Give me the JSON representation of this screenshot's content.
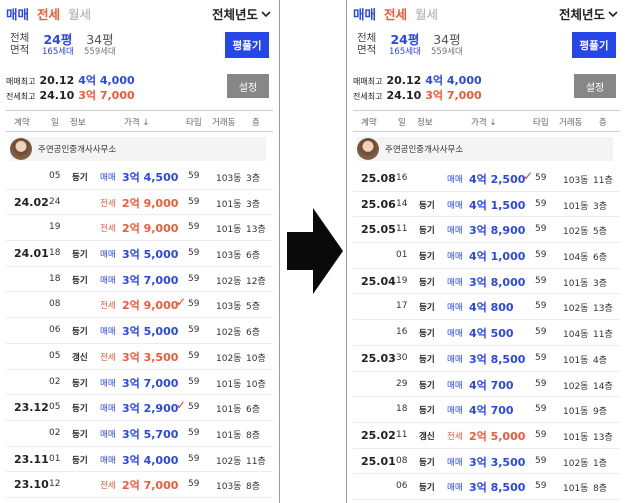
{
  "panels": [
    {
      "tabs": {
        "trade": "매매",
        "jeonse": "전세",
        "wolse": "월세"
      },
      "year_select": "전체년도",
      "area": {
        "label_top": "전체",
        "label_bottom": "면적",
        "selected_big": "24평",
        "selected_small": "165세대",
        "other_big": "34평",
        "other_small": "559세대"
      },
      "compare_label": "평풀기",
      "stats": [
        {
          "label": "매매최고",
          "date": "20.12",
          "price": "4억 4,000",
          "kind": "trade"
        },
        {
          "label": "전세최고",
          "date": "24.10",
          "price": "3억 7,000",
          "kind": "jeonse"
        }
      ],
      "settings_label": "설정",
      "headers": {
        "contract": "계약",
        "day": "일",
        "info": "정보",
        "price": "가격 ↓",
        "type": "타입",
        "dong": "거래동",
        "floor": "층"
      },
      "agent_name": "주연공인중개사사무소",
      "rows": [
        {
          "month": "",
          "day": "05",
          "info": "등기",
          "kind": "매매",
          "price": "3억 4,500",
          "check": "",
          "type": "59",
          "dong": "103동",
          "floor": "3층",
          "deal": "trade"
        },
        {
          "month": "24.02",
          "day": "24",
          "info": "",
          "kind": "전세",
          "price": "2억 9,000",
          "check": "",
          "type": "59",
          "dong": "101동",
          "floor": "3층",
          "deal": "jeonse"
        },
        {
          "month": "",
          "day": "19",
          "info": "",
          "kind": "전세",
          "price": "2억 9,000",
          "check": "",
          "type": "59",
          "dong": "101동",
          "floor": "13층",
          "deal": "jeonse"
        },
        {
          "month": "24.01",
          "day": "18",
          "info": "등기",
          "kind": "매매",
          "price": "3억 5,000",
          "check": "",
          "type": "59",
          "dong": "103동",
          "floor": "6층",
          "deal": "trade"
        },
        {
          "month": "",
          "day": "18",
          "info": "등기",
          "kind": "매매",
          "price": "3억 7,000",
          "check": "",
          "type": "59",
          "dong": "102동",
          "floor": "12층",
          "deal": "trade"
        },
        {
          "month": "",
          "day": "08",
          "info": "",
          "kind": "전세",
          "price": "2억 9,000",
          "check": "✓",
          "type": "59",
          "dong": "103동",
          "floor": "5층",
          "deal": "jeonse"
        },
        {
          "month": "",
          "day": "06",
          "info": "등기",
          "kind": "매매",
          "price": "3억 5,000",
          "check": "",
          "type": "59",
          "dong": "102동",
          "floor": "6층",
          "deal": "trade"
        },
        {
          "month": "",
          "day": "05",
          "info": "갱신",
          "kind": "전세",
          "price": "3억 3,500",
          "check": "",
          "type": "59",
          "dong": "102동",
          "floor": "10층",
          "deal": "jeonse"
        },
        {
          "month": "",
          "day": "02",
          "info": "등기",
          "kind": "매매",
          "price": "3억 7,000",
          "check": "",
          "type": "59",
          "dong": "101동",
          "floor": "10층",
          "deal": "trade"
        },
        {
          "month": "23.12",
          "day": "05",
          "info": "등기",
          "kind": "매매",
          "price": "3억 2,900",
          "check": "✓",
          "type": "59",
          "dong": "101동",
          "floor": "6층",
          "deal": "trade"
        },
        {
          "month": "",
          "day": "02",
          "info": "등기",
          "kind": "매매",
          "price": "3억 5,700",
          "check": "",
          "type": "59",
          "dong": "101동",
          "floor": "8층",
          "deal": "trade"
        },
        {
          "month": "23.11",
          "day": "01",
          "info": "등기",
          "kind": "매매",
          "price": "3억 4,000",
          "check": "",
          "type": "59",
          "dong": "102동",
          "floor": "11층",
          "deal": "trade"
        },
        {
          "month": "23.10",
          "day": "12",
          "info": "",
          "kind": "전세",
          "price": "2억 7,000",
          "check": "",
          "type": "59",
          "dong": "103동",
          "floor": "8층",
          "deal": "jeonse"
        }
      ]
    },
    {
      "tabs": {
        "trade": "매매",
        "jeonse": "전세",
        "wolse": "월세"
      },
      "year_select": "전체년도",
      "area": {
        "label_top": "전체",
        "label_bottom": "면적",
        "selected_big": "24평",
        "selected_small": "165세대",
        "other_big": "34평",
        "other_small": "559세대"
      },
      "compare_label": "평풀기",
      "stats": [
        {
          "label": "매매최고",
          "date": "20.12",
          "price": "4억 4,000",
          "kind": "trade"
        },
        {
          "label": "전세최고",
          "date": "24.10",
          "price": "3억 7,000",
          "kind": "jeonse"
        }
      ],
      "settings_label": "설정",
      "headers": {
        "contract": "계약",
        "day": "일",
        "info": "정보",
        "price": "가격 ↓",
        "type": "타입",
        "dong": "거래동",
        "floor": "층"
      },
      "agent_name": "주연공인중개사사무소",
      "rows": [
        {
          "month": "25.08",
          "day": "16",
          "info": "",
          "kind": "매매",
          "price": "4억 2,500",
          "check": "✓",
          "type": "59",
          "dong": "103동",
          "floor": "11층",
          "deal": "trade"
        },
        {
          "month": "25.06",
          "day": "14",
          "info": "등기",
          "kind": "매매",
          "price": "4억 1,500",
          "check": "",
          "type": "59",
          "dong": "101동",
          "floor": "3층",
          "deal": "trade"
        },
        {
          "month": "25.05",
          "day": "11",
          "info": "등기",
          "kind": "매매",
          "price": "3억 8,900",
          "check": "",
          "type": "59",
          "dong": "102동",
          "floor": "5층",
          "deal": "trade"
        },
        {
          "month": "",
          "day": "01",
          "info": "등기",
          "kind": "매매",
          "price": "4억 1,000",
          "check": "",
          "type": "59",
          "dong": "104동",
          "floor": "6층",
          "deal": "trade"
        },
        {
          "month": "25.04",
          "day": "19",
          "info": "등기",
          "kind": "매매",
          "price": "3억 8,000",
          "check": "",
          "type": "59",
          "dong": "101동",
          "floor": "3층",
          "deal": "trade"
        },
        {
          "month": "",
          "day": "17",
          "info": "등기",
          "kind": "매매",
          "price": "4억 800",
          "check": "",
          "type": "59",
          "dong": "102동",
          "floor": "13층",
          "deal": "trade"
        },
        {
          "month": "",
          "day": "16",
          "info": "등기",
          "kind": "매매",
          "price": "4억 500",
          "check": "",
          "type": "59",
          "dong": "104동",
          "floor": "11층",
          "deal": "trade"
        },
        {
          "month": "25.03",
          "day": "30",
          "info": "등기",
          "kind": "매매",
          "price": "3억 8,500",
          "check": "",
          "type": "59",
          "dong": "101동",
          "floor": "4층",
          "deal": "trade"
        },
        {
          "month": "",
          "day": "29",
          "info": "등기",
          "kind": "매매",
          "price": "4억 700",
          "check": "",
          "type": "59",
          "dong": "102동",
          "floor": "14층",
          "deal": "trade"
        },
        {
          "month": "",
          "day": "18",
          "info": "등기",
          "kind": "매매",
          "price": "4억 700",
          "check": "",
          "type": "59",
          "dong": "101동",
          "floor": "9층",
          "deal": "trade"
        },
        {
          "month": "25.02",
          "day": "11",
          "info": "갱신",
          "kind": "전세",
          "price": "2억 5,000",
          "check": "",
          "type": "59",
          "dong": "101동",
          "floor": "13층",
          "deal": "jeonse"
        },
        {
          "month": "25.01",
          "day": "08",
          "info": "등기",
          "kind": "매매",
          "price": "3억 3,500",
          "check": "",
          "type": "59",
          "dong": "102동",
          "floor": "1층",
          "deal": "trade"
        },
        {
          "month": "",
          "day": "06",
          "info": "등기",
          "kind": "매매",
          "price": "3억 8,500",
          "check": "",
          "type": "59",
          "dong": "101동",
          "floor": "8층",
          "deal": "trade"
        }
      ]
    }
  ]
}
